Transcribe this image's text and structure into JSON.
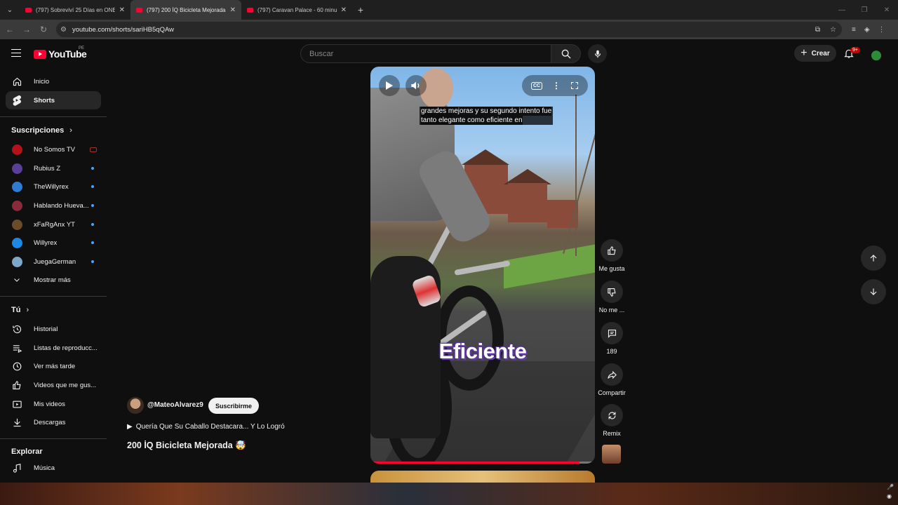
{
  "browser": {
    "tabs": [
      {
        "title": "(797) Sobreviví 25 Días en ONE",
        "active": false
      },
      {
        "title": "(797) 200 ÍQ Bicicleta Mejorada",
        "active": true
      },
      {
        "title": "(797) Caravan Palace - 60 minu",
        "active": false
      }
    ],
    "url": "youtube.com/shorts/sariHB5qQAw"
  },
  "header": {
    "logo_text": "YouTube",
    "country_code": "PE",
    "search_placeholder": "Buscar",
    "create_label": "Crear",
    "notification_count": "9+"
  },
  "sidebar": {
    "main": [
      {
        "label": "Inicio",
        "icon": "home-icon"
      },
      {
        "label": "Shorts",
        "icon": "shorts-icon",
        "active": true
      }
    ],
    "subscriptions_title": "Suscripciones",
    "subscriptions": [
      {
        "label": "No Somos TV",
        "color": "#b3121a",
        "status": "live"
      },
      {
        "label": "Rubius Z",
        "color": "#5a3f9a",
        "status": "new"
      },
      {
        "label": "TheWillyrex",
        "color": "#2f7bd1",
        "status": "new"
      },
      {
        "label": "Hablando Hueva...",
        "color": "#8a2b3b",
        "status": "new"
      },
      {
        "label": "xFaRgAnx YT",
        "color": "#6b4b2a",
        "status": "new"
      },
      {
        "label": "Willyrex",
        "color": "#1e88e5",
        "status": "new"
      },
      {
        "label": "JuegaGerman",
        "color": "#7fa7c9",
        "status": "new"
      }
    ],
    "show_more": "Mostrar más",
    "you_title": "Tú",
    "you_items": [
      {
        "label": "Historial",
        "icon": "history-icon"
      },
      {
        "label": "Listas de reproducc...",
        "icon": "playlists-icon"
      },
      {
        "label": "Ver más tarde",
        "icon": "watch-later-icon"
      },
      {
        "label": "Videos que me gus...",
        "icon": "liked-videos-icon"
      },
      {
        "label": "Mis videos",
        "icon": "my-videos-icon"
      },
      {
        "label": "Descargas",
        "icon": "downloads-icon"
      }
    ],
    "explore_title": "Explorar",
    "explore_items": [
      {
        "label": "Música",
        "icon": "music-icon"
      }
    ]
  },
  "player": {
    "subtitle_line1": "grandes mejoras y su segundo intento fue",
    "subtitle_line2": "tanto elegante como eficiente en",
    "overlay_word": "Eficiente",
    "progress": 0.93,
    "cc_label": "CC"
  },
  "actions": {
    "like_label": "Me gusta",
    "dislike_label": "No me ...",
    "comments_count": "189",
    "share_label": "Compartir",
    "remix_label": "Remix"
  },
  "channel": {
    "handle": "@MateoAlvarez9",
    "subscribe_label": "Suscribirme",
    "linked_video": "Quería Que Su Caballo Destacara... Y Lo Logró",
    "title": "200 İQ Bicicleta Mejorada 🤯"
  }
}
